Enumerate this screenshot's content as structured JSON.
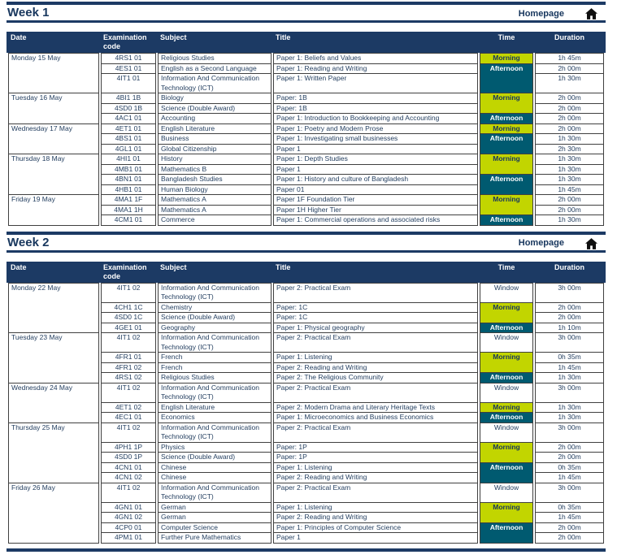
{
  "colors": {
    "navy": "#1c3a64",
    "morning": "#c2d500",
    "afternoon": "#005a70",
    "row_tint": "#d9e9e4",
    "border": "#404040",
    "body_text": "#243f60"
  },
  "icons": {
    "home": "house-icon"
  },
  "homepage": {
    "label": "Homepage"
  },
  "columns": [
    "Date",
    "Examination code",
    "Subject",
    "Title",
    "Time",
    "Duration"
  ],
  "weeks": [
    {
      "title": "Week 1",
      "days": [
        {
          "date": "Monday 15 May",
          "shaded": true,
          "sessions": [
            {
              "time": "Morning",
              "rows": [
                {
                  "code": "4RS1 01",
                  "subject": "Religious Studies",
                  "title": "Paper 1: Beliefs and Values",
                  "duration": "1h 45m"
                }
              ]
            },
            {
              "time": "Afternoon",
              "rows": [
                {
                  "code": "4ES1 01",
                  "subject": "English as a Second Language",
                  "title": "Paper 1: Reading and Writing",
                  "duration": "2h 00m"
                },
                {
                  "code": "4IT1 01",
                  "subject": "Information And Communication Technology (ICT)",
                  "title": "Paper 1: Written Paper",
                  "duration": "1h 30m"
                }
              ]
            }
          ]
        },
        {
          "date": "Tuesday 16 May",
          "shaded": false,
          "sessions": [
            {
              "time": "Morning",
              "rows": [
                {
                  "code": "4BI1 1B",
                  "subject": "Biology",
                  "title": "Paper: 1B",
                  "duration": "2h 00m"
                },
                {
                  "code": "4SD0 1B",
                  "subject": "Science (Double Award)",
                  "title": "Paper: 1B",
                  "duration": "2h 00m"
                }
              ]
            },
            {
              "time": "Afternoon",
              "rows": [
                {
                  "code": "4AC1 01",
                  "subject": "Accounting",
                  "title": "Paper 1: Introduction to Bookkeeping and Accounting",
                  "duration": "2h 00m"
                }
              ]
            }
          ]
        },
        {
          "date": "Wednesday 17 May",
          "shaded": true,
          "sessions": [
            {
              "time": "Morning",
              "rows": [
                {
                  "code": "4ET1 01",
                  "subject": "English Literature",
                  "title": "Paper 1: Poetry and Modern Prose",
                  "duration": "2h 00m"
                }
              ]
            },
            {
              "time": "Afternoon",
              "rows": [
                {
                  "code": "4BS1 01",
                  "subject": "Business",
                  "title": "Paper 1: Investigating small businesses",
                  "duration": "1h 30m"
                },
                {
                  "code": "4GL1 01",
                  "subject": "Global Citizenship",
                  "title": "Paper 1",
                  "duration": "2h 30m"
                }
              ]
            }
          ]
        },
        {
          "date": "Thursday 18 May",
          "shaded": false,
          "sessions": [
            {
              "time": "Morning",
              "rows": [
                {
                  "code": "4HI1 01",
                  "subject": "History",
                  "title": "Paper 1: Depth Studies",
                  "duration": "1h 30m"
                },
                {
                  "code": "4MB1 01",
                  "subject": "Mathematics B",
                  "title": "Paper 1",
                  "duration": "1h 30m"
                }
              ]
            },
            {
              "time": "Afternoon",
              "rows": [
                {
                  "code": "4BN1 01",
                  "subject": "Bangladesh Studies",
                  "title": "Paper 1: History and culture of Bangladesh",
                  "duration": "1h 30m"
                },
                {
                  "code": "4HB1 01",
                  "subject": "Human Biology",
                  "title": "Paper 01",
                  "duration": "1h 45m"
                }
              ]
            }
          ]
        },
        {
          "date": "Friday 19 May",
          "shaded": true,
          "sessions": [
            {
              "time": "Morning",
              "rows": [
                {
                  "code": "4MA1 1F",
                  "subject": "Mathematics A",
                  "title": "Paper 1F Foundation Tier",
                  "duration": "2h 00m"
                },
                {
                  "code": "4MA1 1H",
                  "subject": "Mathematics A",
                  "title": "Paper 1H Higher Tier",
                  "duration": "2h 00m"
                }
              ]
            },
            {
              "time": "Afternoon",
              "rows": [
                {
                  "code": "4CM1 01",
                  "subject": "Commerce",
                  "title": "Paper 1: Commercial operations and associated risks",
                  "duration": "1h 30m"
                }
              ]
            }
          ]
        }
      ]
    },
    {
      "title": "Week 2",
      "days": [
        {
          "date": "Monday 22 May",
          "shaded": true,
          "sessions": [
            {
              "time": "Window",
              "rows": [
                {
                  "code": "4IT1 02",
                  "subject": "Information And Communication Technology (ICT)",
                  "title": "Paper 2: Practical Exam",
                  "duration": "3h 00m"
                }
              ]
            },
            {
              "time": "Morning",
              "rows": [
                {
                  "code": "4CH1 1C",
                  "subject": "Chemistry",
                  "title": "Paper: 1C",
                  "duration": "2h 00m"
                },
                {
                  "code": "4SD0 1C",
                  "subject": "Science (Double Award)",
                  "title": "Paper: 1C",
                  "duration": "2h 00m"
                }
              ]
            },
            {
              "time": "Afternoon",
              "rows": [
                {
                  "code": "4GE1 01",
                  "subject": "Geography",
                  "title": "Paper 1: Physical geography",
                  "duration": "1h 10m"
                }
              ]
            }
          ]
        },
        {
          "date": "Tuesday 23 May",
          "shaded": false,
          "sessions": [
            {
              "time": "Window",
              "rows": [
                {
                  "code": "4IT1 02",
                  "subject": "Information And Communication Technology (ICT)",
                  "title": "Paper 2: Practical Exam",
                  "duration": "3h 00m"
                }
              ]
            },
            {
              "time": "Morning",
              "rows": [
                {
                  "code": "4FR1 01",
                  "subject": "French",
                  "title": "Paper 1: Listening",
                  "duration": "0h 35m"
                },
                {
                  "code": "4FR1 02",
                  "subject": "French",
                  "title": "Paper 2: Reading and Writing",
                  "duration": "1h 45m"
                }
              ]
            },
            {
              "time": "Afternoon",
              "rows": [
                {
                  "code": "4RS1 02",
                  "subject": "Religious Studies",
                  "title": "Paper 2: The Religious Community",
                  "duration": "1h 30m"
                }
              ]
            }
          ]
        },
        {
          "date": "Wednesday 24 May",
          "shaded": true,
          "sessions": [
            {
              "time": "Window",
              "rows": [
                {
                  "code": "4IT1 02",
                  "subject": "Information And Communication Technology (ICT)",
                  "title": "Paper 2: Practical Exam",
                  "duration": "3h 00m"
                }
              ]
            },
            {
              "time": "Morning",
              "rows": [
                {
                  "code": "4ET1 02",
                  "subject": "English Literature",
                  "title": "Paper 2: Modern Drama and Literary Heritage Texts",
                  "duration": "1h 30m"
                }
              ]
            },
            {
              "time": "Afternoon",
              "rows": [
                {
                  "code": "4EC1 01",
                  "subject": "Economics",
                  "title": "Paper 1: Microeconomics and Business Economics",
                  "duration": "1h 30m"
                }
              ]
            }
          ]
        },
        {
          "date": "Thursday 25 May",
          "shaded": false,
          "sessions": [
            {
              "time": "Window",
              "rows": [
                {
                  "code": "4IT1 02",
                  "subject": "Information And Communication Technology (ICT)",
                  "title": "Paper 2: Practical Exam",
                  "duration": "3h 00m"
                }
              ]
            },
            {
              "time": "Morning",
              "rows": [
                {
                  "code": "4PH1 1P",
                  "subject": "Physics",
                  "title": "Paper: 1P",
                  "duration": "2h 00m"
                },
                {
                  "code": "4SD0 1P",
                  "subject": "Science (Double Award)",
                  "title": "Paper: 1P",
                  "duration": "2h 00m"
                }
              ]
            },
            {
              "time": "Afternoon",
              "rows": [
                {
                  "code": "4CN1 01",
                  "subject": "Chinese",
                  "title": "Paper 1: Listening",
                  "duration": "0h 35m"
                },
                {
                  "code": "4CN1 02",
                  "subject": "Chinese",
                  "title": "Paper 2: Reading and Writing",
                  "duration": "1h 45m"
                }
              ]
            }
          ]
        },
        {
          "date": "Friday 26 May",
          "shaded": true,
          "sessions": [
            {
              "time": "Window",
              "rows": [
                {
                  "code": "4IT1 02",
                  "subject": "Information And Communication Technology (ICT)",
                  "title": "Paper 2: Practical Exam",
                  "duration": "3h 00m"
                }
              ]
            },
            {
              "time": "Morning",
              "rows": [
                {
                  "code": "4GN1 01",
                  "subject": "German",
                  "title": "Paper 1: Listening",
                  "duration": "0h 35m"
                },
                {
                  "code": "4GN1 02",
                  "subject": "German",
                  "title": "Paper 2: Reading and Writing",
                  "duration": "1h 45m"
                }
              ]
            },
            {
              "time": "Afternoon",
              "rows": [
                {
                  "code": "4CP0 01",
                  "subject": "Computer Science",
                  "title": "Paper 1: Principles of Computer Science",
                  "duration": "2h 00m"
                },
                {
                  "code": "4PM1 01",
                  "subject": "Further Pure Mathematics",
                  "title": "Paper 1",
                  "duration": "2h 00m"
                }
              ]
            }
          ]
        }
      ]
    }
  ]
}
